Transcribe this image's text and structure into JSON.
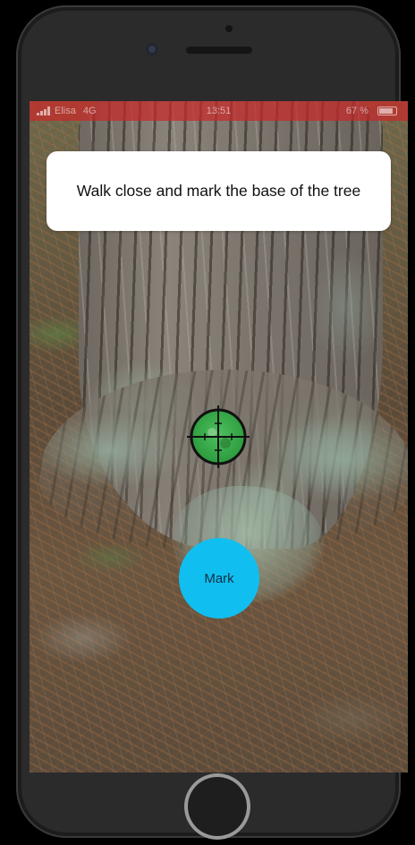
{
  "status_bar": {
    "carrier": "Elisa",
    "network": "4G",
    "time": "13:51",
    "battery": "67 %"
  },
  "instruction": {
    "text": "Walk close and mark the base of the tree"
  },
  "crosshair": {
    "icon": "crosshair-icon",
    "fill_color": "#2faa44"
  },
  "mark_button": {
    "label": "Mark",
    "color": "#11bef0"
  }
}
